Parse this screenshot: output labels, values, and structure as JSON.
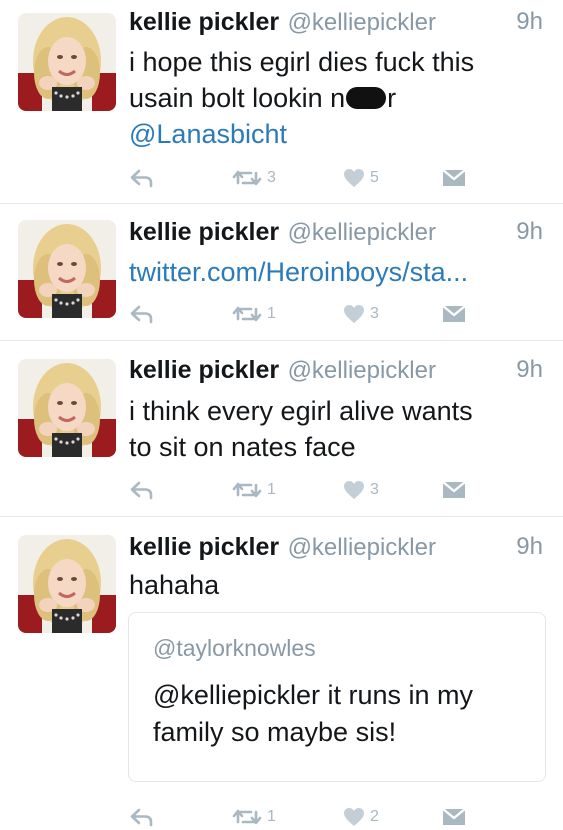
{
  "tweets": [
    {
      "name": "kellie pickler",
      "handle": "@kelliepickler",
      "time": "9h",
      "text_line1": "i hope this egirl dies fuck this",
      "text_line2_pre": "usain bolt lookin n",
      "text_line2_post": "r",
      "mention": "@Lanasbicht",
      "retweets": "3",
      "likes": "5"
    },
    {
      "name": "kellie pickler",
      "handle": "@kelliepickler",
      "time": "9h",
      "link": "twitter.com/Heroinboys/sta...",
      "retweets": "1",
      "likes": "3"
    },
    {
      "name": "kellie pickler",
      "handle": "@kelliepickler",
      "time": "9h",
      "text_line1": "i think every egirl alive wants",
      "text_line2": "to sit on nates face",
      "retweets": "1",
      "likes": "3"
    },
    {
      "name": "kellie pickler",
      "handle": "@kelliepickler",
      "time": "9h",
      "text": "hahaha",
      "quote": {
        "handle": "@taylorknowles",
        "text_line1": "@kelliepickler it runs in my",
        "text_line2": "family so maybe sis!"
      },
      "retweets": "1",
      "likes": "2"
    }
  ],
  "icons": {
    "reply": "reply-icon",
    "retweet": "retweet-icon",
    "like": "heart-icon",
    "dm": "direct-message-icon"
  },
  "colors": {
    "link": "#2b7bb9",
    "meta": "#8899a6",
    "action": "#aab8c2",
    "divider": "#e1e8ed"
  }
}
